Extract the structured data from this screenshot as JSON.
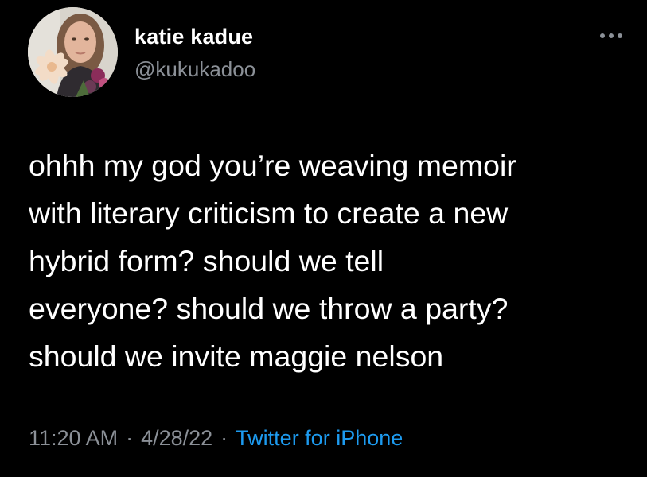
{
  "author": {
    "display_name": "katie kadue",
    "handle": "@kukukadoo"
  },
  "tweet": {
    "lines": [
      "ohhh my god you’re weaving memoir",
      "with literary criticism to create a new",
      "hybrid form? should we tell",
      "everyone? should we throw a party?",
      "should we invite maggie nelson"
    ]
  },
  "meta": {
    "time": "11:20 AM",
    "separator": "·",
    "date": "4/28/22",
    "source": "Twitter for iPhone"
  },
  "icons": {
    "more": "more-icon",
    "avatar": "avatar"
  },
  "colors": {
    "background": "#000000",
    "text": "#ffffff",
    "muted": "#8b9097",
    "link": "#1d9bf0"
  }
}
